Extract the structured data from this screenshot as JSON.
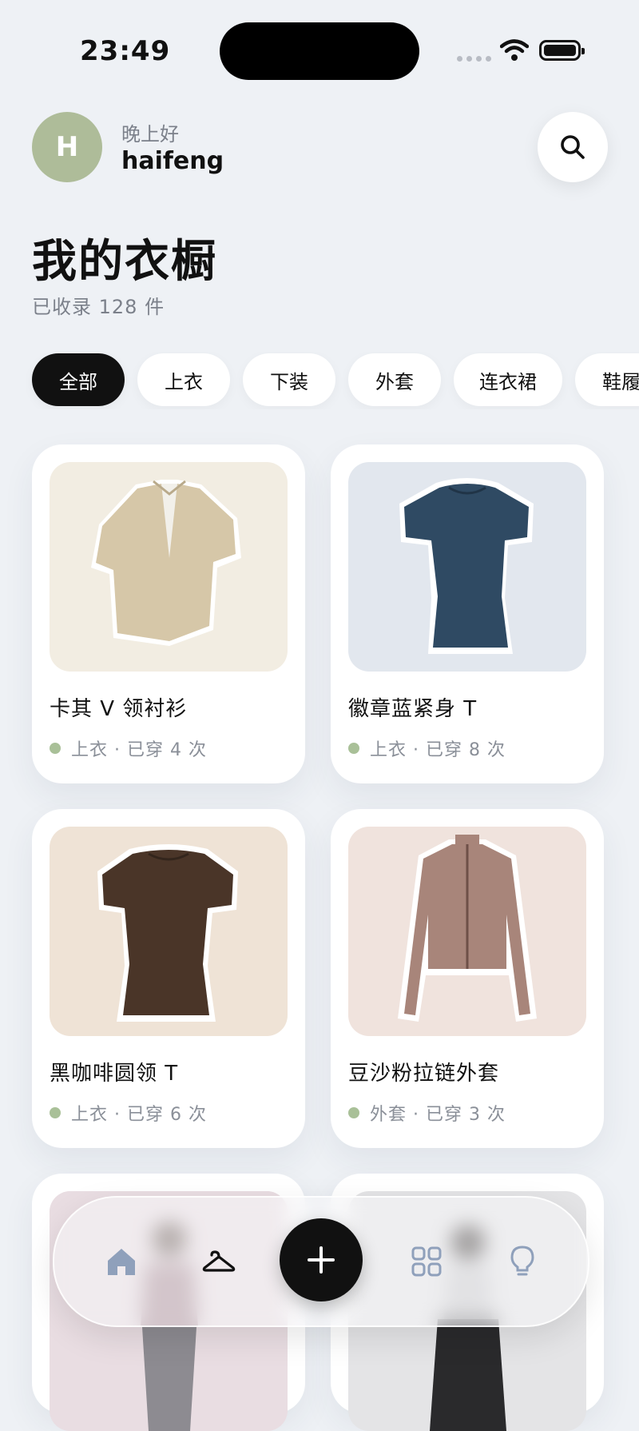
{
  "status_bar": {
    "time": "23:49"
  },
  "header": {
    "avatar_initial": "H",
    "greeting": "晚上好",
    "username": "haifeng",
    "title": "我的衣橱",
    "count_text": "已收录 128 件"
  },
  "filters": [
    {
      "label": "全部",
      "active": true
    },
    {
      "label": "上衣",
      "active": false
    },
    {
      "label": "下装",
      "active": false
    },
    {
      "label": "外套",
      "active": false
    },
    {
      "label": "连衣裙",
      "active": false
    },
    {
      "label": "鞋履",
      "active": false
    }
  ],
  "items": [
    {
      "name": "卡其 V 领衬衫",
      "meta": "上衣 · 已穿 4 次",
      "bg": "#f2ede2",
      "garment_color": "#d6c7a8"
    },
    {
      "name": "徽章蓝紧身 T",
      "meta": "上衣 · 已穿 8 次",
      "bg": "#e2e7ee",
      "garment_color": "#2f4a63"
    },
    {
      "name": "黑咖啡圆领 T",
      "meta": "上衣 · 已穿 6 次",
      "bg": "#efe3d6",
      "garment_color": "#4a3528"
    },
    {
      "name": "豆沙粉拉链外套",
      "meta": "外套 · 已穿 3 次",
      "bg": "#f0e3dd",
      "garment_color": "#a8857a"
    }
  ],
  "nav": {
    "items": [
      "home-icon",
      "hanger-icon",
      "plus-icon",
      "grid-icon",
      "lightbulb-icon"
    ],
    "active": "hanger-icon"
  },
  "colors": {
    "accent": "#111111",
    "status_dot": "#a9c098",
    "avatar_bg": "#aebc99"
  }
}
